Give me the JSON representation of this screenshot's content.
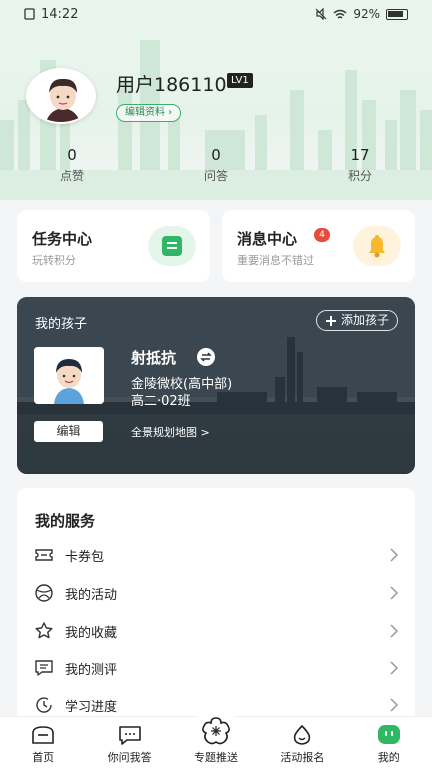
{
  "status_bar": {
    "time": "14:22",
    "battery": "92%"
  },
  "profile": {
    "username": "用户186110",
    "level": "LV1",
    "edit_label": "编辑资料 ›"
  },
  "stats": [
    {
      "value": "0",
      "label": "点赞"
    },
    {
      "value": "0",
      "label": "问答"
    },
    {
      "value": "17",
      "label": "积分"
    }
  ],
  "task_center": {
    "title": "任务中心",
    "subtitle": "玩转积分"
  },
  "message_center": {
    "title": "消息中心",
    "subtitle": "重要消息不错过",
    "badge": "4"
  },
  "kids": {
    "title": "我的孩子",
    "add_label": "添加孩子",
    "name": "射抵抗",
    "school": "金陵微校(高中部)",
    "class": "高二·02班",
    "edit_label": "编辑",
    "map_label": "全景规划地图 >"
  },
  "services": {
    "title": "我的服务",
    "items": [
      {
        "label": "卡券包",
        "icon": "ticket-icon"
      },
      {
        "label": "我的活动",
        "icon": "ball-icon"
      },
      {
        "label": "我的收藏",
        "icon": "star-icon"
      },
      {
        "label": "我的测评",
        "icon": "chat-list-icon"
      },
      {
        "label": "学习进度",
        "icon": "progress-icon"
      }
    ]
  },
  "bottom_nav": [
    {
      "label": "首页",
      "icon": "home-icon"
    },
    {
      "label": "你问我答",
      "icon": "qa-icon"
    },
    {
      "label": "专题推送",
      "icon": "flower-icon"
    },
    {
      "label": "活动报名",
      "icon": "drop-icon"
    },
    {
      "label": "我的",
      "icon": "me-icon"
    }
  ],
  "colors": {
    "accent": "#3cae6a",
    "badge": "#e84b3c",
    "bell": "#f5b82e"
  }
}
